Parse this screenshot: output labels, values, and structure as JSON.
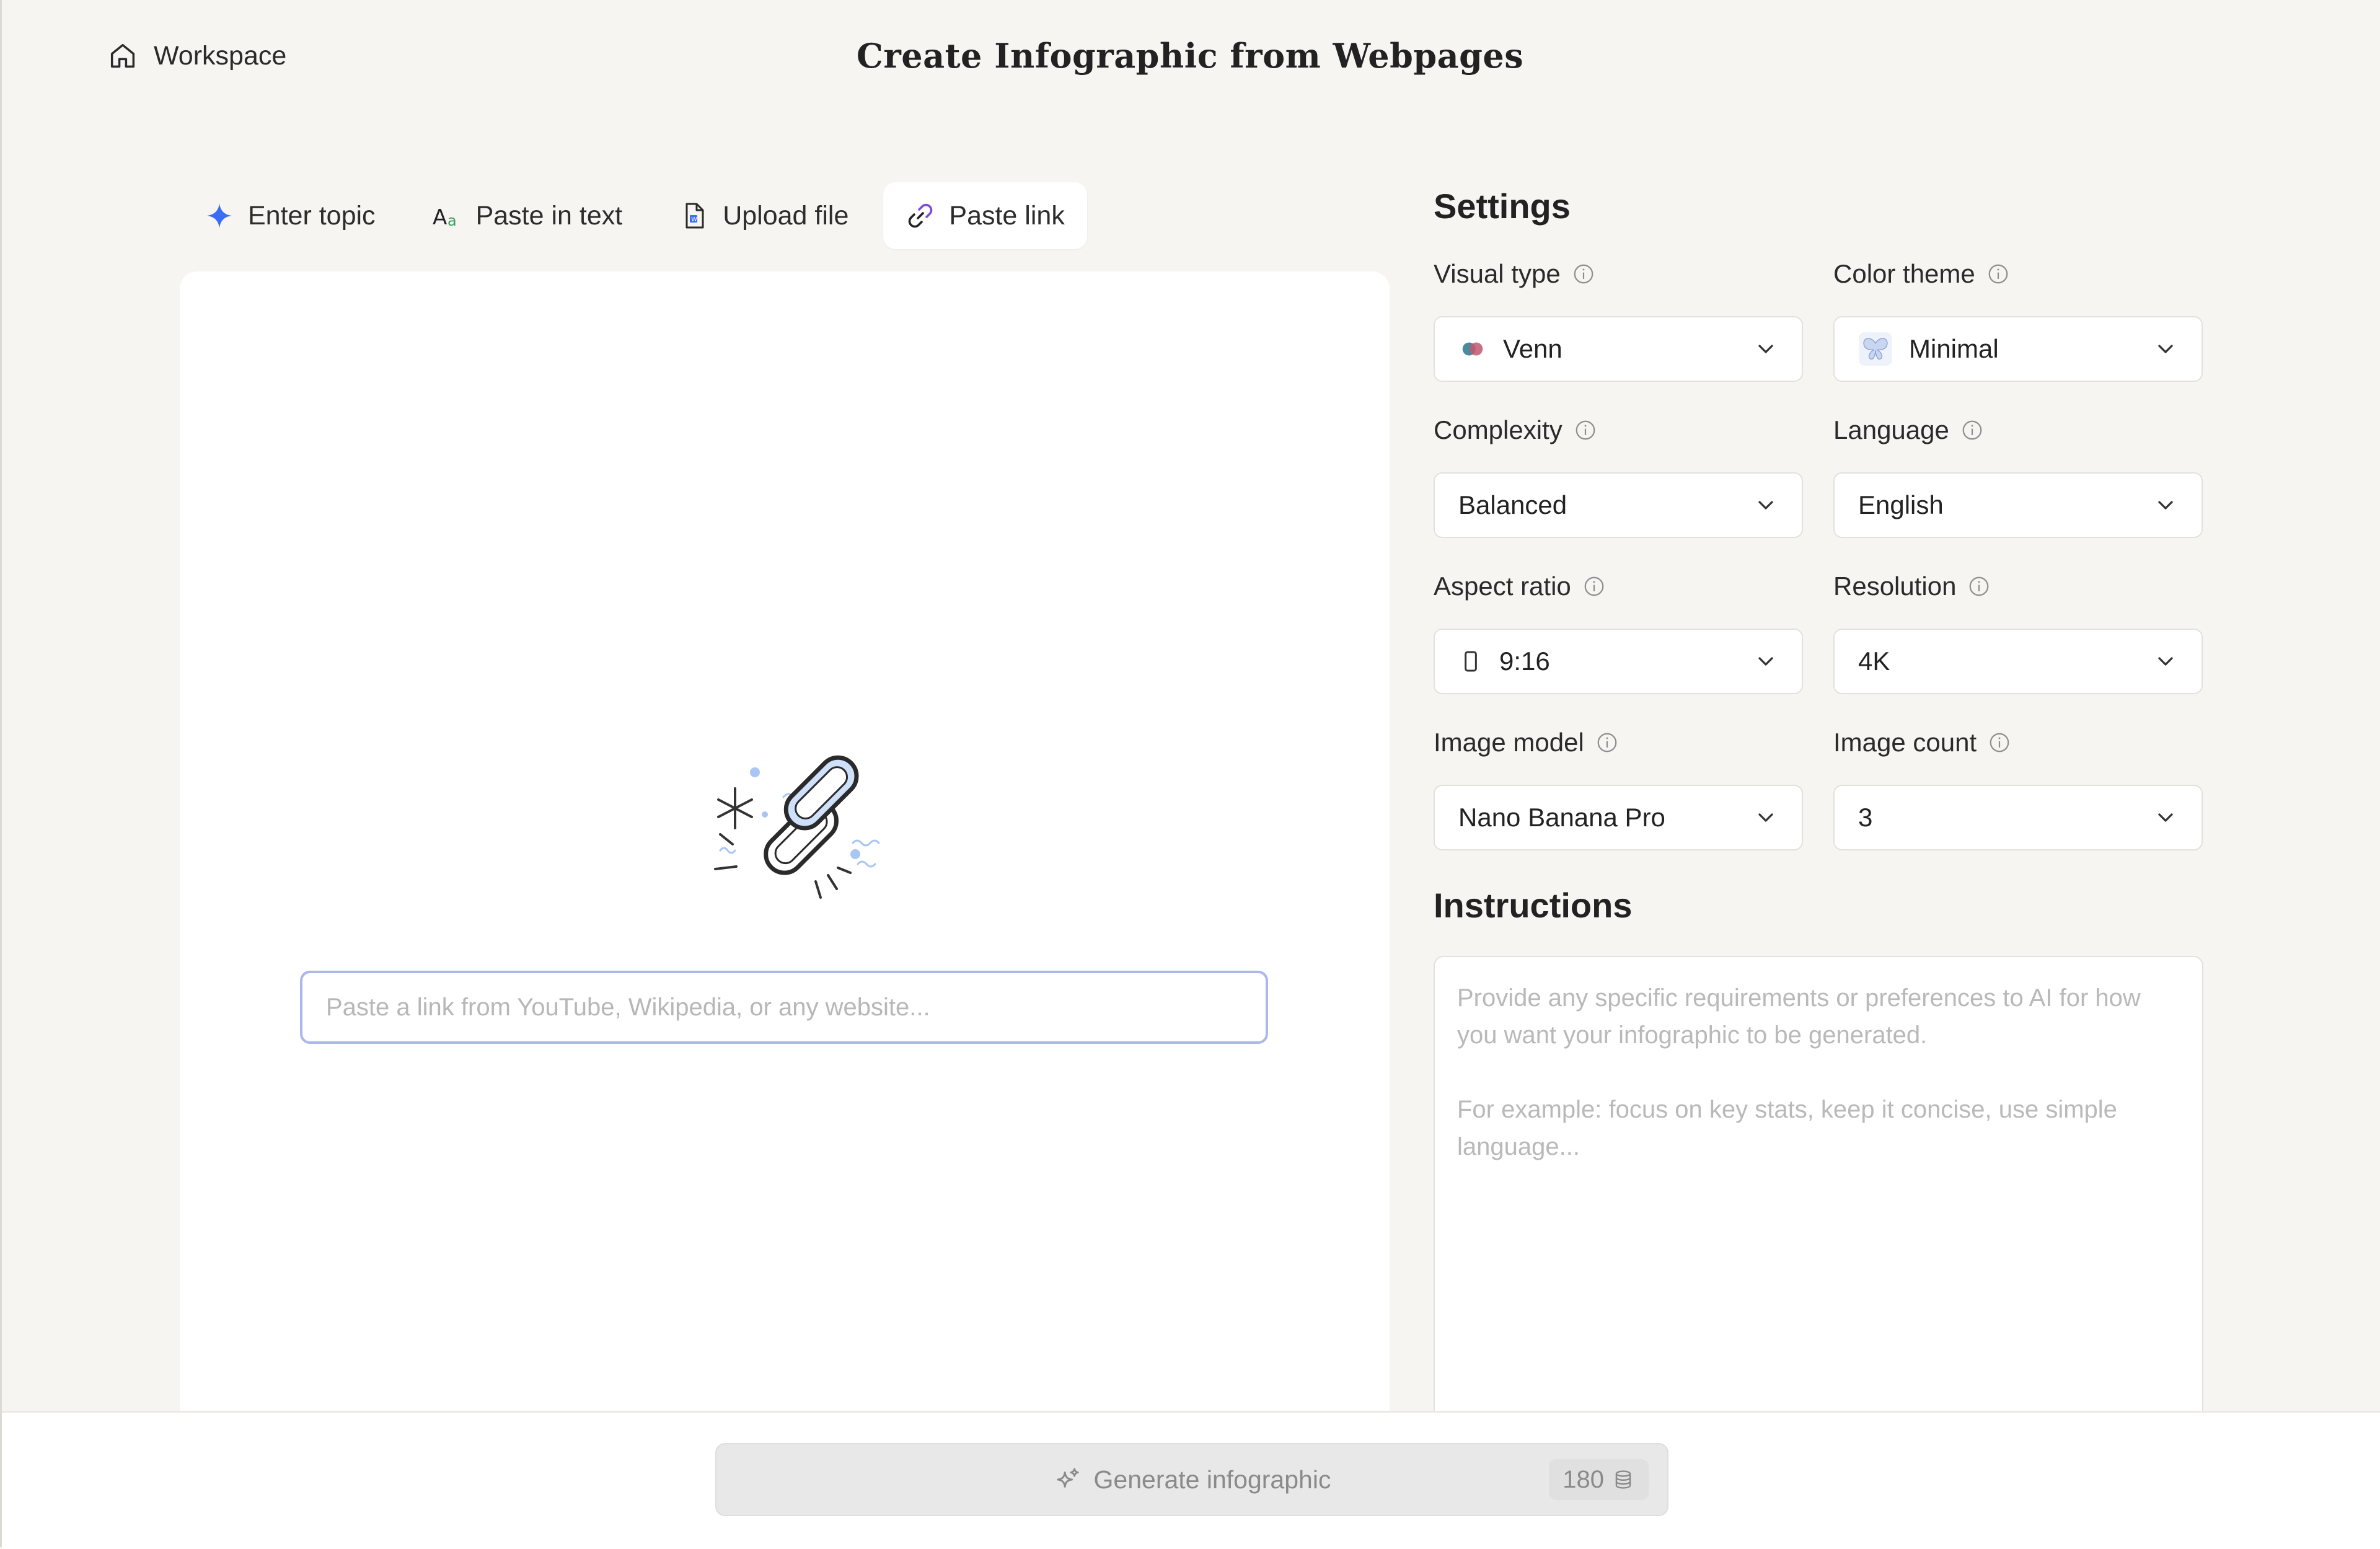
{
  "header": {
    "workspace_label": "Workspace",
    "title": "Create Infographic from Webpages"
  },
  "tabs": [
    {
      "label": "Enter topic",
      "icon": "sparkle-icon",
      "active": false
    },
    {
      "label": "Paste in text",
      "icon": "text-aa-icon",
      "active": false
    },
    {
      "label": "Upload file",
      "icon": "document-icon",
      "active": false
    },
    {
      "label": "Paste link",
      "icon": "link-icon",
      "active": true
    }
  ],
  "source": {
    "link_placeholder": "Paste a link from YouTube, Wikipedia, or any website...",
    "link_value": ""
  },
  "settings": {
    "title": "Settings",
    "visual_type": {
      "label": "Visual type",
      "value": "Venn"
    },
    "color_theme": {
      "label": "Color theme",
      "value": "Minimal"
    },
    "complexity": {
      "label": "Complexity",
      "value": "Balanced"
    },
    "language": {
      "label": "Language",
      "value": "English"
    },
    "aspect_ratio": {
      "label": "Aspect ratio",
      "value": "9:16"
    },
    "resolution": {
      "label": "Resolution",
      "value": "4K"
    },
    "image_model": {
      "label": "Image model",
      "value": "Nano Banana Pro"
    },
    "image_count": {
      "label": "Image count",
      "value": "3"
    }
  },
  "instructions": {
    "title": "Instructions",
    "placeholder": "Provide any specific requirements or preferences to AI for how you want your infographic to be generated.\n\nFor example: focus on key stats, keep it concise, use simple language..."
  },
  "footer": {
    "generate_label": "Generate infographic",
    "credits": "180"
  },
  "colors": {
    "background": "#f6f5f2",
    "panel": "#ffffff",
    "input_focus_border": "#aab8ec",
    "accent_blue": "#3b6cf6",
    "illustration_fill": "#cfe0fb",
    "venn_left": "#4a8a9a",
    "venn_right": "#c2566e",
    "button_disabled": "#e8e8e8"
  }
}
